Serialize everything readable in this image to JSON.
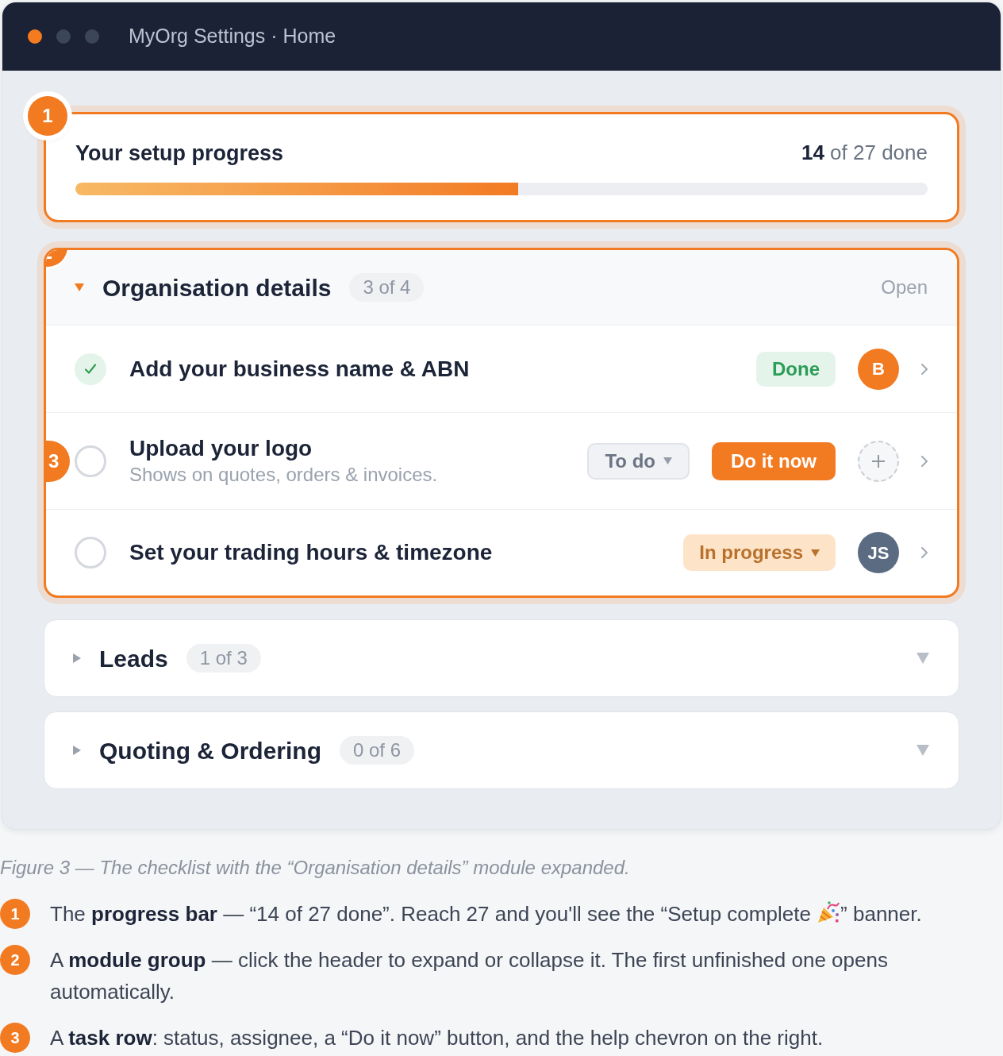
{
  "window": {
    "title": "MyOrg Settings · Home",
    "controls": [
      {
        "color": "#f47b20"
      },
      {
        "color": "#3b4658"
      },
      {
        "color": "#3b4658"
      }
    ]
  },
  "progress": {
    "callout": "1",
    "title": "Your setup progress",
    "summary": "**14** of 27 done",
    "level": 0.52
  },
  "modules": [
    {
      "title": "Organisation details",
      "count": "3 of 4",
      "expanded": true,
      "highlighted": true,
      "callout_marker": true,
      "status": "Open",
      "tasks": [
        {
          "title": "Add your business name & ABN",
          "done": true,
          "status": {
            "kind": "done",
            "label": "Done"
          },
          "assignee": {
            "kind": "avatar",
            "initials": "B",
            "color": "#f27b22"
          }
        },
        {
          "title": "Upload your logo",
          "subtitle": "Shows on quotes, orders & invoices.",
          "done": false,
          "callout": "3",
          "status": {
            "kind": "todo",
            "label": "To do"
          },
          "action": "Do it now",
          "assignee": {
            "kind": "add"
          }
        },
        {
          "title": "Set your trading hours & timezone",
          "done": false,
          "status": {
            "kind": "progress",
            "label": "In progress"
          },
          "assignee": {
            "kind": "avatar",
            "initials": "JS",
            "color": "#5b6b82"
          }
        }
      ]
    },
    {
      "title": "Leads",
      "count": "1 of 3",
      "expanded": false,
      "highlighted": false,
      "callout_marker": false
    },
    {
      "title": "Quoting & Ordering",
      "count": "0 of 6",
      "expanded": false,
      "highlighted": false,
      "callout_marker": false
    }
  ],
  "caption": "Figure 3 — The checklist with the “Organisation details” module expanded.",
  "notes": [
    {
      "number": "1",
      "segments": [
        "The **progress bar** — “14 of 27 done”. Reach 27 and you'll see the “Setup complete ",
        "” banner."
      ]
    },
    {
      "number": "2",
      "segments": [
        "A **module group** — click the header to expand or collapse it. The first unfinished one opens automatically."
      ]
    },
    {
      "number": "3",
      "segments": [
        "A **task row**: status, assignee, a “Do it now” button, and the help chevron on the right."
      ]
    }
  ]
}
